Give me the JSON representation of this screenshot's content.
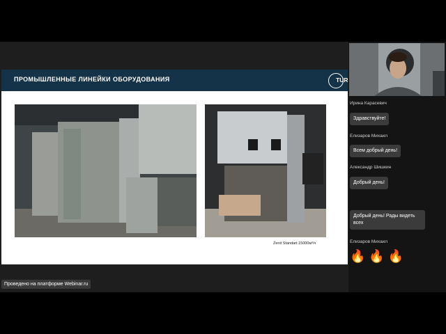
{
  "slide": {
    "title": "ПРОМЫШЛЕННЫЕ ЛИНЕЙКИ ОБОРУДОВАНИЯ",
    "logo_text": "TURKOV",
    "caption": "Zenit Standart 15000м³/ч"
  },
  "platform_badge": "Проведено на платформе Webinar.ru",
  "chat": {
    "messages": [
      {
        "author": "Ирина Карасевич",
        "text": "Здравствуйте!"
      },
      {
        "author": "Елизаров Михаил",
        "text": "Всем добрый день!"
      },
      {
        "author": "Александр Шишкин",
        "text": "Добрый день!"
      },
      {
        "author": "",
        "text": "Добрый день! Рады видеть всех"
      },
      {
        "author": "Елизаров Михаил",
        "text": "🔥 🔥 🔥"
      }
    ]
  },
  "colors": {
    "header_bg": "#143348",
    "stage_bg": "#1e1e1e",
    "sidebar_bg": "#141414",
    "bubble_bg": "#3b3b3b"
  }
}
